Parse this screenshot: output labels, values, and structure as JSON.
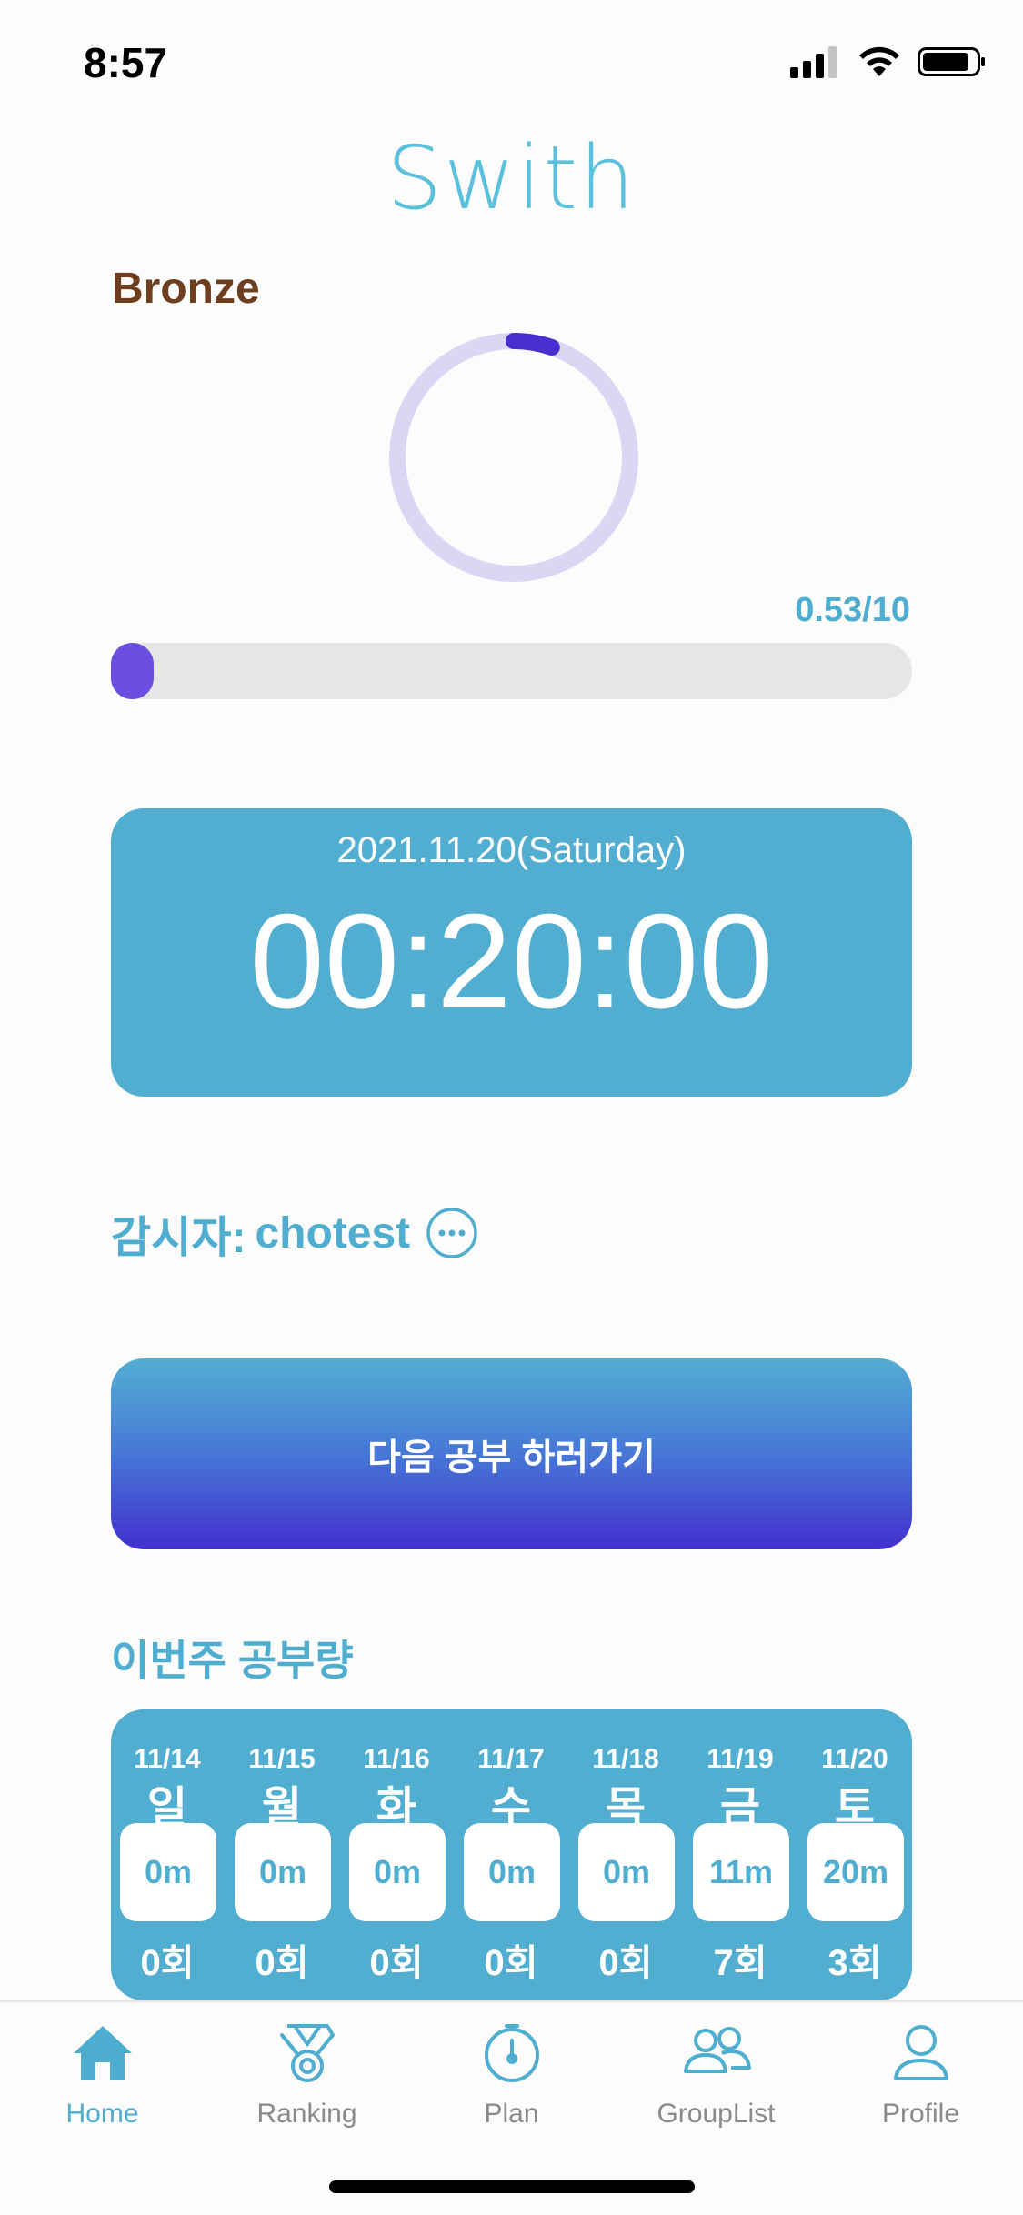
{
  "status_bar": {
    "time": "8:57"
  },
  "app": {
    "title": "Swith"
  },
  "tier": {
    "name": "Bronze",
    "ring_progress": 0.053
  },
  "progress": {
    "label": "0.53/10",
    "current": 0.53,
    "max": 10
  },
  "timer": {
    "date": "2021.11.20(Saturday)",
    "elapsed": "00:20:00"
  },
  "monitor": {
    "label": "감시자:",
    "name": "chotest"
  },
  "next_button": {
    "label": "다음 공부 하러가기"
  },
  "week": {
    "title": "이번주 공부량",
    "days": [
      {
        "date": "11/14",
        "day": "일",
        "time": "0m",
        "count": "0회"
      },
      {
        "date": "11/15",
        "day": "월",
        "time": "0m",
        "count": "0회"
      },
      {
        "date": "11/16",
        "day": "화",
        "time": "0m",
        "count": "0회"
      },
      {
        "date": "11/17",
        "day": "수",
        "time": "0m",
        "count": "0회"
      },
      {
        "date": "11/18",
        "day": "목",
        "time": "0m",
        "count": "0회"
      },
      {
        "date": "11/19",
        "day": "금",
        "time": "11m",
        "count": "7회"
      },
      {
        "date": "11/20",
        "day": "토",
        "time": "20m",
        "count": "3회"
      }
    ]
  },
  "tabs": [
    {
      "label": "Home",
      "icon": "house-icon",
      "active": true
    },
    {
      "label": "Ranking",
      "icon": "medal-icon",
      "active": false
    },
    {
      "label": "Plan",
      "icon": "stopwatch-icon",
      "active": false
    },
    {
      "label": "GroupList",
      "icon": "group-icon",
      "active": false
    },
    {
      "label": "Profile",
      "icon": "person-icon",
      "active": false
    }
  ],
  "colors": {
    "accent": "#4fadd0",
    "tier": "#6e3f1f",
    "progress_fill": "#6a4fe0",
    "ring_track": "#dcd6f5",
    "ring_fill": "#4a2fd0"
  }
}
